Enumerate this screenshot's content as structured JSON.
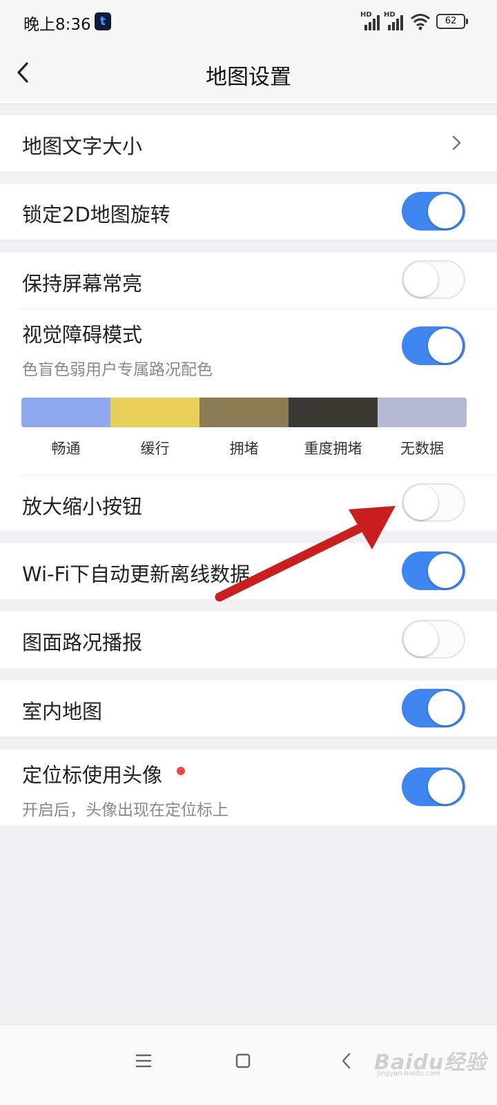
{
  "status_bar": {
    "time": "晚上8:36",
    "carrier_glyph": "t",
    "signal_1_label": "HD",
    "signal_2_label": "HD",
    "battery": "62"
  },
  "header": {
    "title": "地图设置"
  },
  "settings": {
    "text_size": {
      "label": "地图文字大小"
    },
    "lock_2d": {
      "label": "锁定2D地图旋转",
      "enabled": true
    },
    "keep_screen_on": {
      "label": "保持屏幕常亮",
      "enabled": false
    },
    "accessibility": {
      "label": "视觉障碍模式",
      "description": "色盲色弱用户专属路况配色",
      "enabled": true,
      "legend": [
        {
          "label": "畅通",
          "color": "#8fa7ed"
        },
        {
          "label": "缓行",
          "color": "#e8cf5a"
        },
        {
          "label": "拥堵",
          "color": "#8c7c55"
        },
        {
          "label": "重度拥堵",
          "color": "#3a3832"
        },
        {
          "label": "无数据",
          "color": "#b5bad3"
        }
      ]
    },
    "zoom_buttons": {
      "label": "放大缩小按钮",
      "enabled": false
    },
    "wifi_update": {
      "label": "Wi-Fi下自动更新离线数据",
      "enabled": true
    },
    "traffic_broadcast": {
      "label": "图面路况播报",
      "enabled": false
    },
    "indoor_map": {
      "label": "室内地图",
      "enabled": true
    },
    "avatar_marker": {
      "label": "定位标使用头像",
      "description": "开启后，头像出现在定位标上",
      "enabled": true,
      "new_badge": true
    }
  },
  "watermark": {
    "brand": "Baidu经验",
    "url": "jingyan.baidu.com"
  },
  "colors": {
    "accent": "#3f86f0",
    "annotation_arrow": "#c8201e",
    "badge": "#f04646"
  }
}
